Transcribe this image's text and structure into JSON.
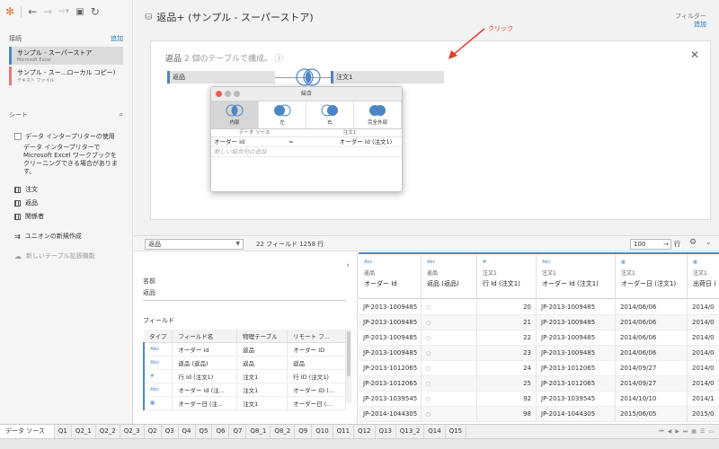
{
  "colors": {
    "accent": "#4a86c5",
    "annotation": "#e53b2c",
    "text_connection": "#e07a7a"
  },
  "left": {
    "connections_label": "接続",
    "connections_add": "追加",
    "connections": [
      {
        "name": "サンプル - スーパーストア",
        "sub": "Microsoft Excel"
      },
      {
        "name": "サンプル - スー...ローカル コピー)",
        "sub": "テキスト ファイル"
      }
    ],
    "sheets_label": "シート",
    "data_interpreter_label": "データ インタープリターの使用",
    "data_interpreter_desc": "データ インタープリターで Microsoft Excel ワークブックをクリーニングできる場合があります。",
    "tables": [
      "注文",
      "返品",
      "関係者"
    ],
    "new_union": "ユニオンの新規作成",
    "new_extension": "新しいテーブル拡張機能"
  },
  "canvas": {
    "title": "返品+ (サンプル - スーパーストア)",
    "filter_label": "フィルター",
    "filter_add": "追加",
    "card_title_name": "返品",
    "card_title_rest": "2 個のテーブルで構成。",
    "left_table": "返品",
    "right_table": "注文1",
    "annotation": "クリック"
  },
  "dialog": {
    "title": "結合",
    "join_types": [
      "内部",
      "左",
      "右",
      "完全外部"
    ],
    "clause_head_left": "データ ソース",
    "clause_head_right": "注文1",
    "clause": {
      "left": "オーダー Id",
      "op": "=",
      "right": "オーダー Id (注文1)"
    },
    "new_clause": "新しい結合句の追加"
  },
  "midbar": {
    "table_select": "返品",
    "field_count": "22 フィールド 1258 行",
    "rows_value": "100",
    "rows_label": "行"
  },
  "meta": {
    "name_label": "名前",
    "name_value": "返品",
    "fields_label": "フィールド",
    "headers": [
      "タイプ",
      "フィールド名",
      "物理テーブル",
      "リモート フ..."
    ],
    "rows": [
      {
        "type": "Abc",
        "name": "オーダー Id",
        "table": "返品",
        "remote": "オーダー ID"
      },
      {
        "type": "Abc",
        "name": "返品 (返品)",
        "table": "返品",
        "remote": "返品"
      },
      {
        "type": "#",
        "name": "行 Id (注文1)",
        "table": "注文1",
        "remote": "行 ID (注文1)"
      },
      {
        "type": "Abc",
        "name": "オーダー Id (注...",
        "table": "注文1",
        "remote": "オーダー ID (..."
      },
      {
        "type": "▦",
        "name": "オーダー日 (注...",
        "table": "注文1",
        "remote": "オーダー日 (..."
      }
    ]
  },
  "grid": {
    "columns": [
      {
        "type": "Abc",
        "source": "返品",
        "field": "オーダー Id"
      },
      {
        "type": "Abc",
        "source": "返品",
        "field": "返品 (返品)"
      },
      {
        "type": "#",
        "source": "注文1",
        "field": "行 Id (注文1)"
      },
      {
        "type": "Abc",
        "source": "注文1",
        "field": "オーダー Id (注文1)"
      },
      {
        "type": "▦",
        "source": "注文1",
        "field": "オーダー日 (注文1)"
      },
      {
        "type": "▦",
        "source": "注文1",
        "field": "出荷日 ("
      }
    ],
    "rows": [
      [
        "JP-2013-1009485",
        "○",
        "20",
        "JP-2013-1009485",
        "2014/06/06",
        "2014/0"
      ],
      [
        "JP-2013-1009485",
        "○",
        "21",
        "JP-2013-1009485",
        "2014/06/06",
        "2014/0"
      ],
      [
        "JP-2013-1009485",
        "○",
        "22",
        "JP-2013-1009485",
        "2014/06/06",
        "2014/0"
      ],
      [
        "JP-2013-1009485",
        "○",
        "23",
        "JP-2013-1009485",
        "2014/06/06",
        "2014/0"
      ],
      [
        "JP-2013-1012065",
        "○",
        "24",
        "JP-2013-1012065",
        "2014/09/27",
        "2014/0"
      ],
      [
        "JP-2013-1012065",
        "○",
        "25",
        "JP-2013-1012065",
        "2014/09/27",
        "2014/0"
      ],
      [
        "JP-2013-1039545",
        "○",
        "92",
        "JP-2013-1039545",
        "2014/10/10",
        "2014/1"
      ],
      [
        "JP-2014-1044305",
        "○",
        "98",
        "JP-2014-1044305",
        "2015/06/05",
        "2015/0"
      ]
    ]
  },
  "tabs": [
    "データ ソース",
    "Q1",
    "Q2_1",
    "Q2_2",
    "Q2_3",
    "Q2",
    "Q3",
    "Q4",
    "Q5",
    "Q6",
    "Q7",
    "Q8_1",
    "Q8_2",
    "Q9",
    "Q10",
    "Q11",
    "Q12",
    "Q13",
    "Q13_2",
    "Q14",
    "Q15"
  ]
}
